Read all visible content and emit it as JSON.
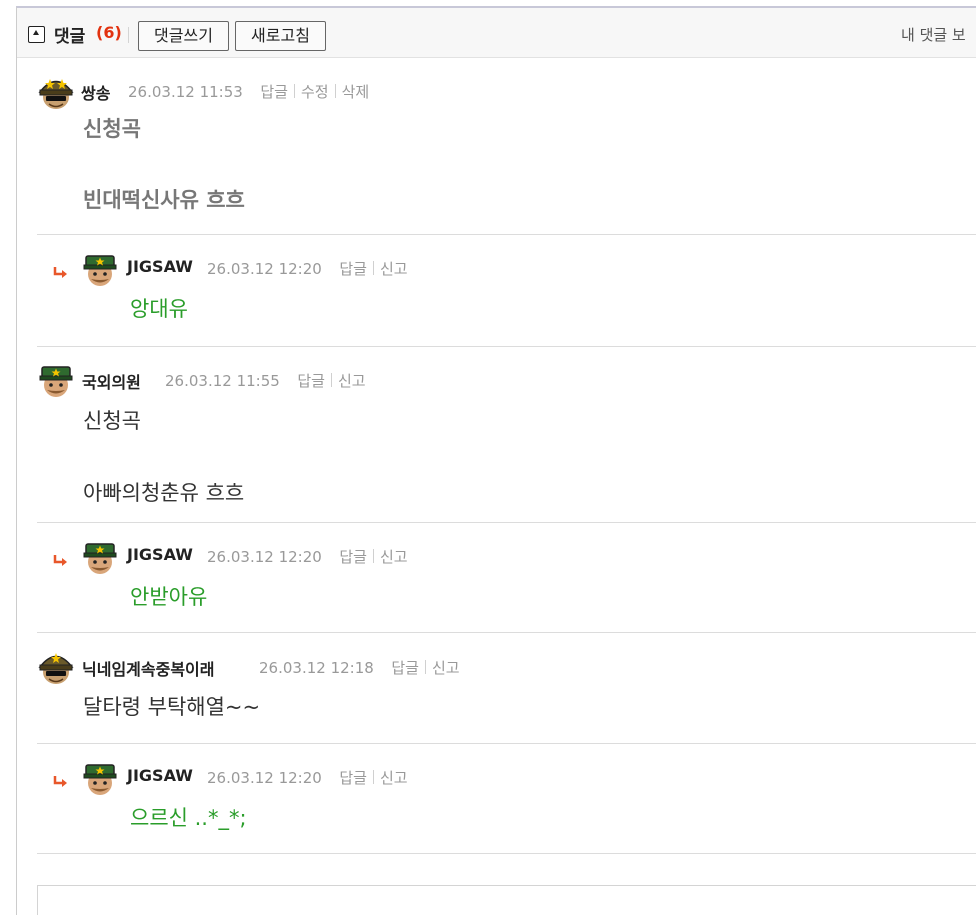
{
  "header": {
    "title": "댓글",
    "count": "(6)",
    "write_button": "댓글쓰기",
    "refresh_button": "새로고침",
    "my_comments": "내 댓글 보"
  },
  "comments": [
    {
      "author": "쌍송",
      "date": "26.03.12 11:53",
      "actions": [
        "답글",
        "수정",
        "삭제"
      ],
      "lines": [
        "신청곡",
        "빈대떡신사유 흐흐"
      ],
      "avatar_icon": "soldier-avatar-gold-helmet-icon"
    },
    {
      "author": "JIGSAW",
      "date": "26.03.12 12:20",
      "actions": [
        "답글",
        "신고"
      ],
      "lines": [
        "앙대유"
      ],
      "avatar_icon": "soldier-avatar-green-cap-icon",
      "is_reply": true
    },
    {
      "author": "국외의원",
      "date": "26.03.12 11:55",
      "actions": [
        "답글",
        "신고"
      ],
      "lines": [
        "신청곡",
        "아빠의청춘유 흐흐"
      ],
      "avatar_icon": "soldier-avatar-green-cap-icon"
    },
    {
      "author": "JIGSAW",
      "date": "26.03.12 12:20",
      "actions": [
        "답글",
        "신고"
      ],
      "lines": [
        "안받아유"
      ],
      "avatar_icon": "soldier-avatar-green-cap-icon",
      "is_reply": true
    },
    {
      "author": "닉네임계속중복이래",
      "date": "26.03.12 12:18",
      "actions": [
        "답글",
        "신고"
      ],
      "lines": [
        "달타령 부탁해열~~"
      ],
      "avatar_icon": "soldier-avatar-gold-helmet-icon"
    },
    {
      "author": "JIGSAW",
      "date": "26.03.12 12:20",
      "actions": [
        "답글",
        "신고"
      ],
      "lines": [
        "으르신 ..*_*;"
      ],
      "avatar_icon": "soldier-avatar-green-cap-icon",
      "is_reply": true
    }
  ],
  "colors": {
    "count": "#e2320f",
    "reply_text": "#2a9d2a",
    "reply_arrow": "#e8572a"
  }
}
